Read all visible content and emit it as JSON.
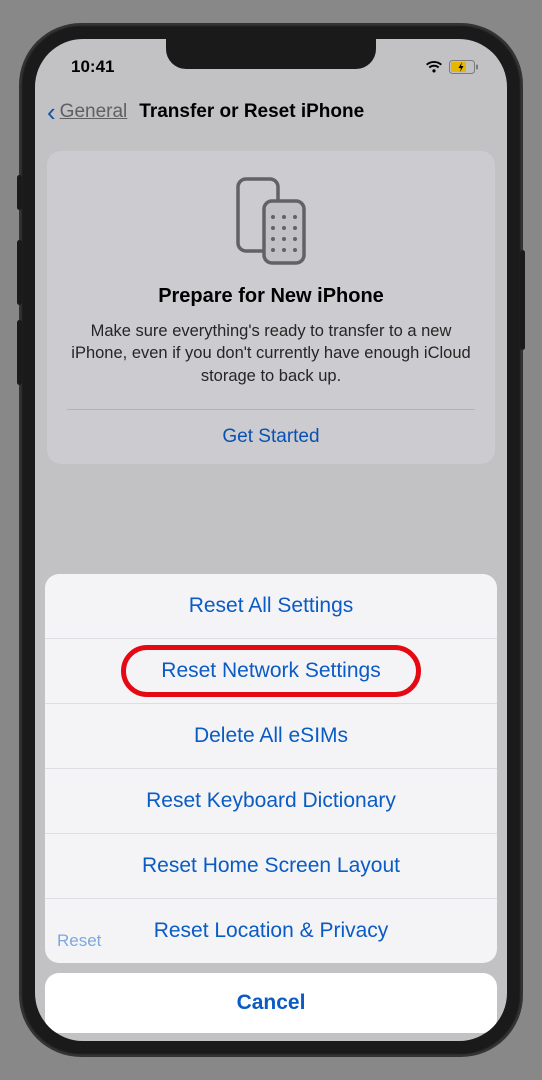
{
  "status": {
    "time": "10:41"
  },
  "nav": {
    "back": "General",
    "title": "Transfer or Reset iPhone"
  },
  "card": {
    "title": "Prepare for New iPhone",
    "desc": "Make sure everything's ready to transfer to a new iPhone, even if you don't currently have enough iCloud storage to back up.",
    "action": "Get Started"
  },
  "sheet": {
    "items": [
      "Reset All Settings",
      "Reset Network Settings",
      "Delete All eSIMs",
      "Reset Keyboard Dictionary",
      "Reset Home Screen Layout",
      "Reset Location & Privacy"
    ],
    "cancel": "Cancel",
    "peek": "Reset"
  },
  "highlighted_index": 1
}
